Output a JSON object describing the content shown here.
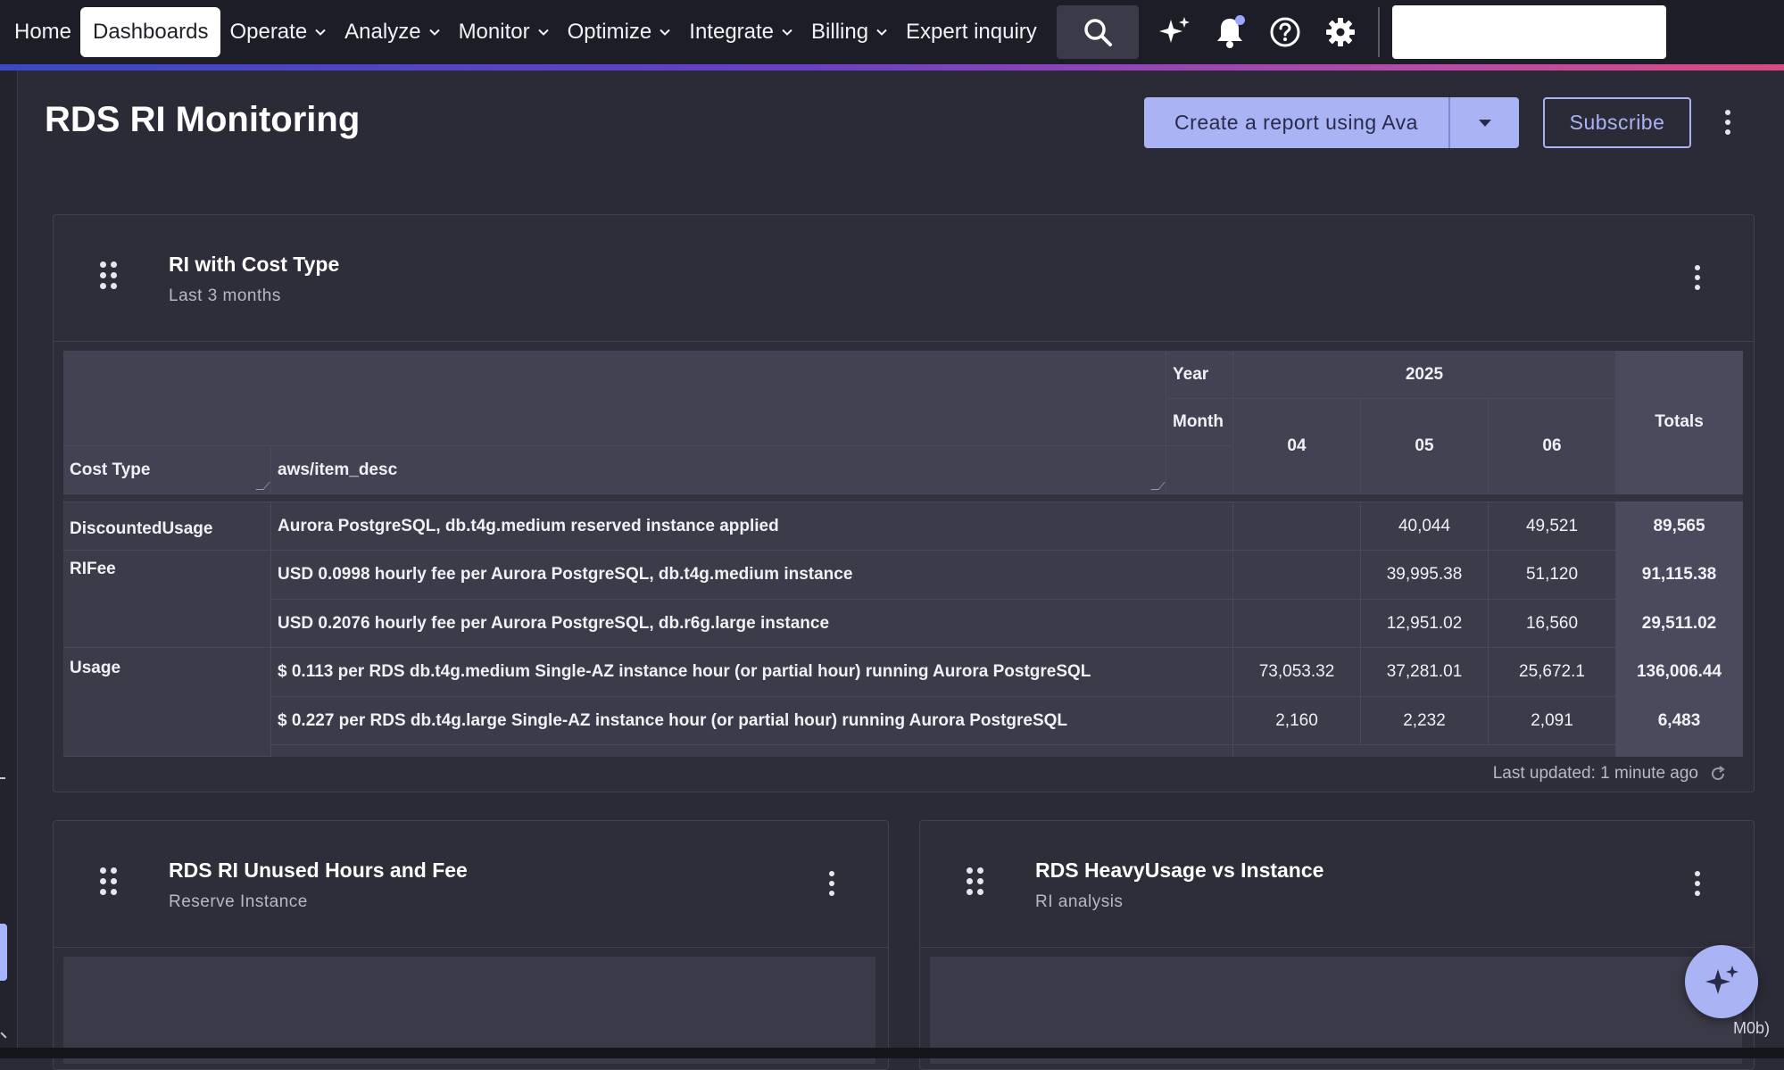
{
  "nav": {
    "items": [
      {
        "label": "Home",
        "dropdown": false,
        "active": false
      },
      {
        "label": "Dashboards",
        "dropdown": false,
        "active": true
      },
      {
        "label": "Operate",
        "dropdown": true,
        "active": false
      },
      {
        "label": "Analyze",
        "dropdown": true,
        "active": false
      },
      {
        "label": "Monitor",
        "dropdown": true,
        "active": false
      },
      {
        "label": "Optimize",
        "dropdown": true,
        "active": false
      },
      {
        "label": "Integrate",
        "dropdown": true,
        "active": false
      },
      {
        "label": "Billing",
        "dropdown": true,
        "active": false
      },
      {
        "label": "Expert inquiry",
        "dropdown": false,
        "active": false
      }
    ],
    "icons": [
      "search-icon",
      "sparkle-icon",
      "bell-icon",
      "help-icon",
      "gear-icon"
    ]
  },
  "page": {
    "title": "RDS RI Monitoring",
    "ava_button": "Create a report using Ava",
    "subscribe_button": "Subscribe"
  },
  "main_card": {
    "title": "RI with Cost Type",
    "subtitle": "Last 3 months",
    "last_updated": "Last updated: 1 minute ago",
    "table": {
      "year_label": "Year",
      "year_value": "2025",
      "month_label": "Month",
      "row_header_1": "Cost Type",
      "row_header_2": "aws/item_desc",
      "months": [
        "04",
        "05",
        "06"
      ],
      "totals_label": "Totals",
      "groups": [
        {
          "cost_type": "DiscountedUsage",
          "rows": [
            {
              "desc": "Aurora PostgreSQL, db.t4g.medium reserved instance applied",
              "values": [
                "",
                "40,044",
                "49,521"
              ],
              "total": "89,565"
            }
          ]
        },
        {
          "cost_type": "RIFee",
          "rows": [
            {
              "desc": "USD 0.0998 hourly fee per Aurora PostgreSQL, db.t4g.medium instance",
              "values": [
                "",
                "39,995.38",
                "51,120"
              ],
              "total": "91,115.38"
            },
            {
              "desc": "USD 0.2076 hourly fee per Aurora PostgreSQL, db.r6g.large instance",
              "values": [
                "",
                "12,951.02",
                "16,560"
              ],
              "total": "29,511.02"
            }
          ]
        },
        {
          "cost_type": "Usage",
          "rows": [
            {
              "desc": "$ 0.113 per RDS db.t4g.medium Single-AZ instance hour (or partial hour) running Aurora PostgreSQL",
              "values": [
                "73,053.32",
                "37,281.01",
                "25,672.1"
              ],
              "total": "136,006.44"
            },
            {
              "desc": "$ 0.227 per RDS db.t4g.large Single-AZ instance hour (or partial hour) running Aurora PostgreSQL",
              "values": [
                "2,160",
                "2,232",
                "2,091"
              ],
              "total": "6,483"
            }
          ]
        }
      ]
    }
  },
  "card_unused": {
    "title": "RDS RI Unused Hours and Fee",
    "subtitle": "Reserve Instance"
  },
  "card_heavy": {
    "title": "RDS HeavyUsage vs Instance",
    "subtitle": "RI analysis"
  },
  "misc": {
    "tiny_tag": "M0b)"
  },
  "colors": {
    "accent": "#aab4f5",
    "nav_bg": "#1d1d27",
    "page_bg": "#2b2b37"
  }
}
